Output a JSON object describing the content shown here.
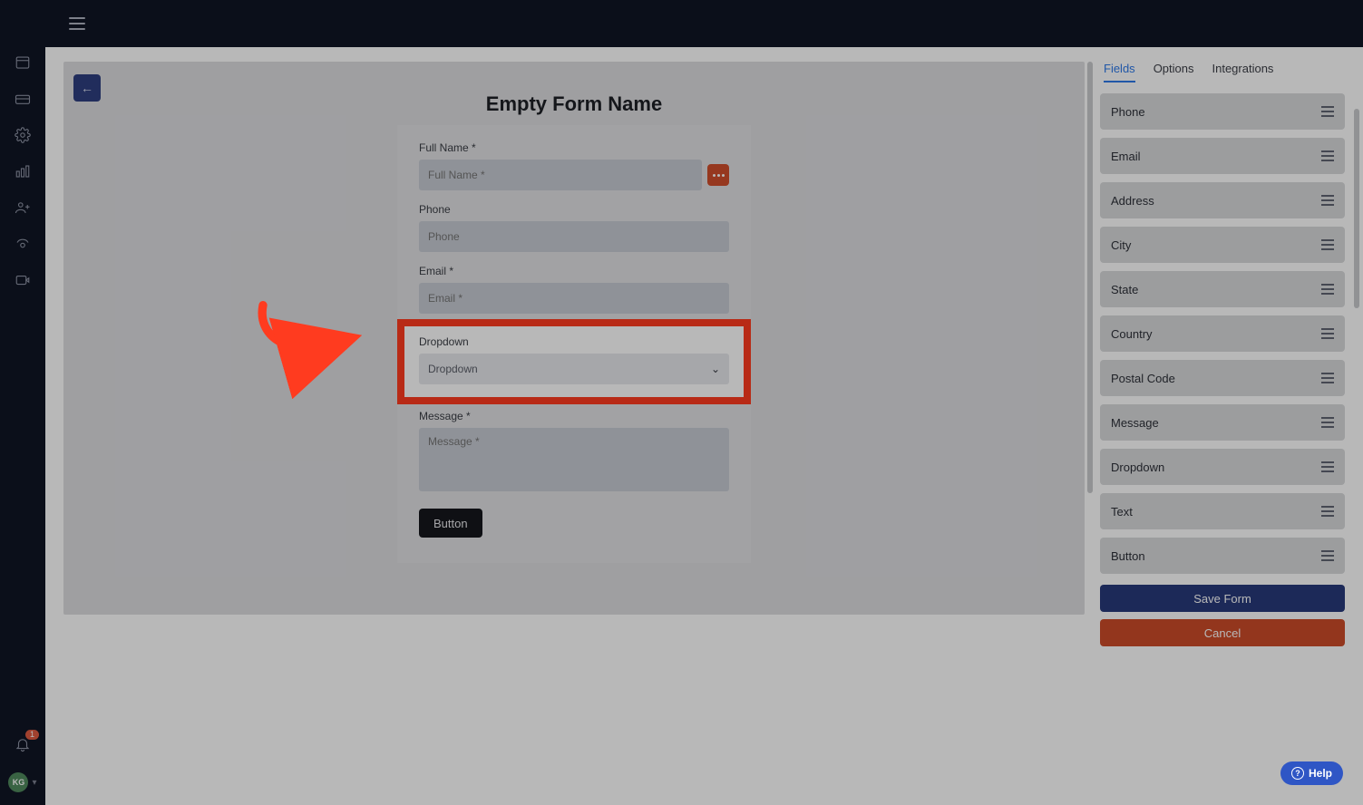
{
  "header": {},
  "sidebar": {
    "notification_count": "1",
    "avatar_initials": "KG"
  },
  "page": {
    "form_title": "Empty Form Name",
    "back_glyph": "←"
  },
  "form": {
    "fields": [
      {
        "label": "Full Name *",
        "placeholder": "Full Name *",
        "has_more": true
      },
      {
        "label": "Phone",
        "placeholder": "Phone"
      },
      {
        "label": "Email *",
        "placeholder": "Email *"
      },
      {
        "label": "Dropdown",
        "placeholder": "Dropdown",
        "dropdown": true,
        "highlight": true
      },
      {
        "label": "Message *",
        "placeholder": "Message *",
        "textarea": true
      }
    ],
    "submit_label": "Button"
  },
  "panel": {
    "tabs": [
      "Fields",
      "Options",
      "Integrations"
    ],
    "active_tab": "Fields",
    "items": [
      "Phone",
      "Email",
      "Address",
      "City",
      "State",
      "Country",
      "Postal Code",
      "Message",
      "Dropdown",
      "Text",
      "Button"
    ],
    "save_label": "Save Form",
    "cancel_label": "Cancel"
  },
  "help": {
    "label": "Help"
  }
}
